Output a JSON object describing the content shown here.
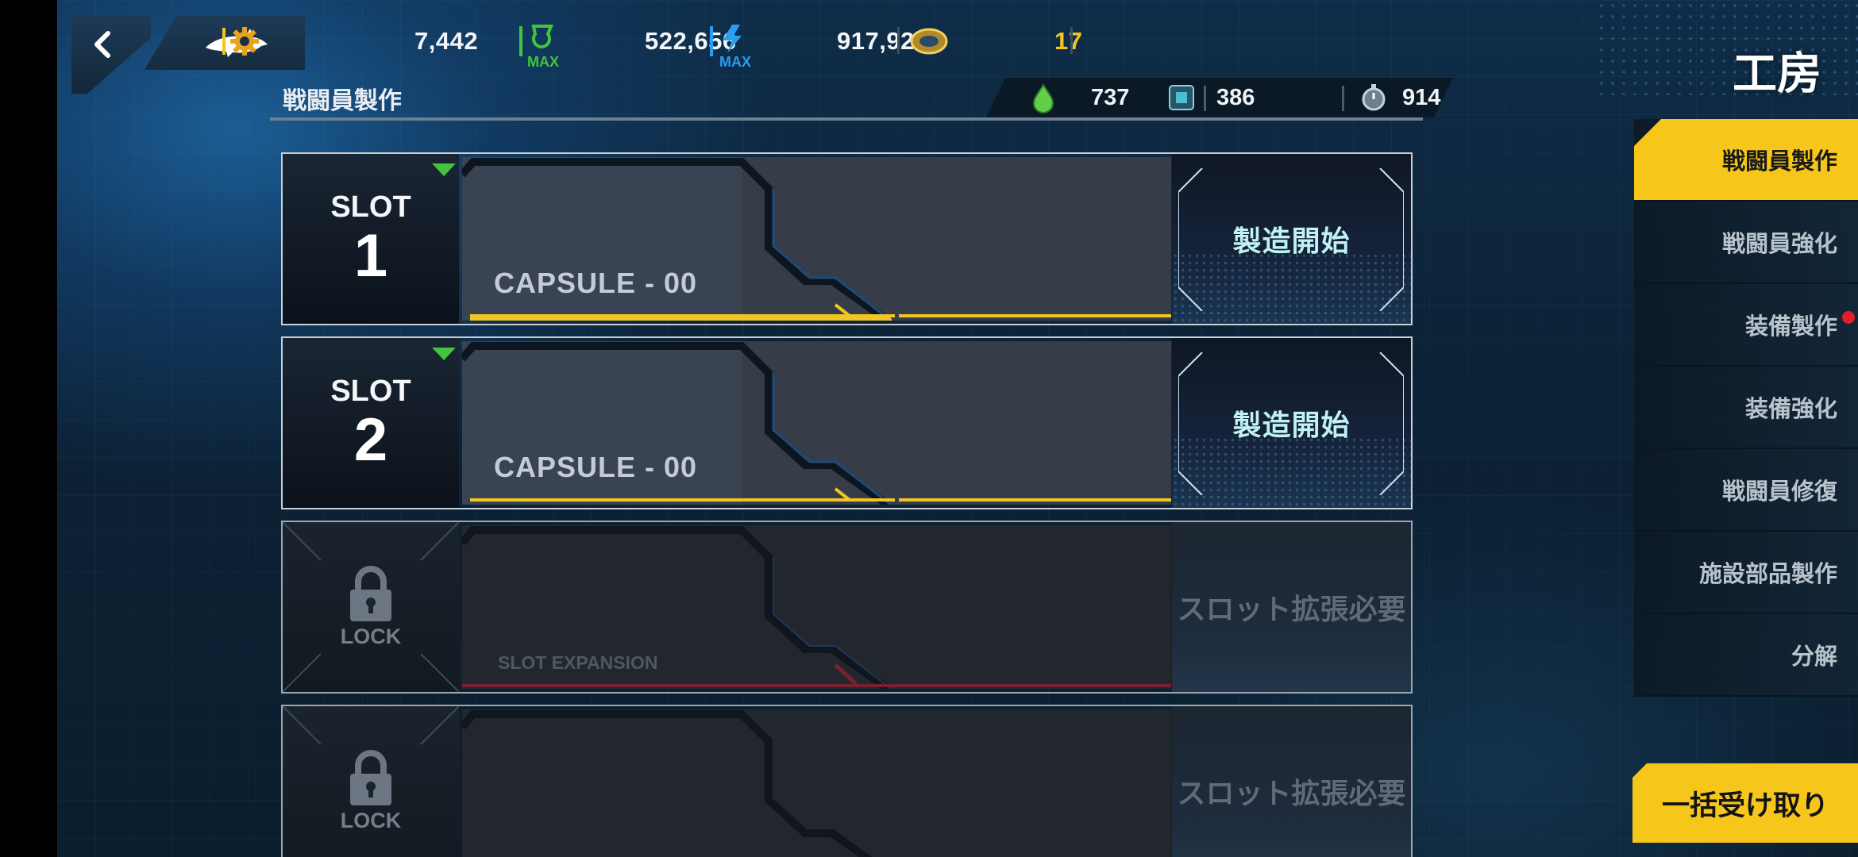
{
  "header": {
    "screen_title": "工房",
    "resources": [
      {
        "name": "gear",
        "icon": "gear-icon",
        "value": "7,442"
      },
      {
        "name": "max-green",
        "icon": "max-green-icon",
        "value": "522,656"
      },
      {
        "name": "max-blue",
        "icon": "max-blue-icon",
        "value": "917,920"
      },
      {
        "name": "ticket",
        "icon": "ticket-icon",
        "value": "17"
      }
    ],
    "max_badge": "MAX"
  },
  "section": {
    "title": "戦闘員製作",
    "materials": [
      {
        "name": "green-drop",
        "icon": "green-drop-icon",
        "value": "737"
      },
      {
        "name": "chip",
        "icon": "chip-icon",
        "value": "386"
      },
      {
        "name": "timer",
        "icon": "timer-icon",
        "value": "914"
      }
    ]
  },
  "slots": [
    {
      "label": "SLOT",
      "number": "1",
      "capsule": "CAPSULE - 00",
      "action": "製造開始",
      "locked": false
    },
    {
      "label": "SLOT",
      "number": "2",
      "capsule": "CAPSULE - 00",
      "action": "製造開始",
      "locked": false
    },
    {
      "lock_text": "LOCK",
      "capsule": "SLOT EXPANSION",
      "action": "スロット拡張必要",
      "locked": true
    },
    {
      "lock_text": "LOCK",
      "action": "スロット拡張必要",
      "locked": true
    }
  ],
  "side_menu": [
    {
      "label": "戦闘員製作",
      "active": true
    },
    {
      "label": "戦闘員強化",
      "active": false
    },
    {
      "label": "装備製作",
      "active": false,
      "badge": true
    },
    {
      "label": "装備強化",
      "active": false
    },
    {
      "label": "戦闘員修復",
      "active": false
    },
    {
      "label": "施設部品製作",
      "active": false
    },
    {
      "label": "分解",
      "active": false
    }
  ],
  "bulk_receive": "一括受け取り",
  "colors": {
    "accent": "#f6c61a",
    "progress_yellow": "#f1c522",
    "lock_red": "#7a2030",
    "notify": "#e51c2a",
    "new_triangle": "#43c43f"
  }
}
